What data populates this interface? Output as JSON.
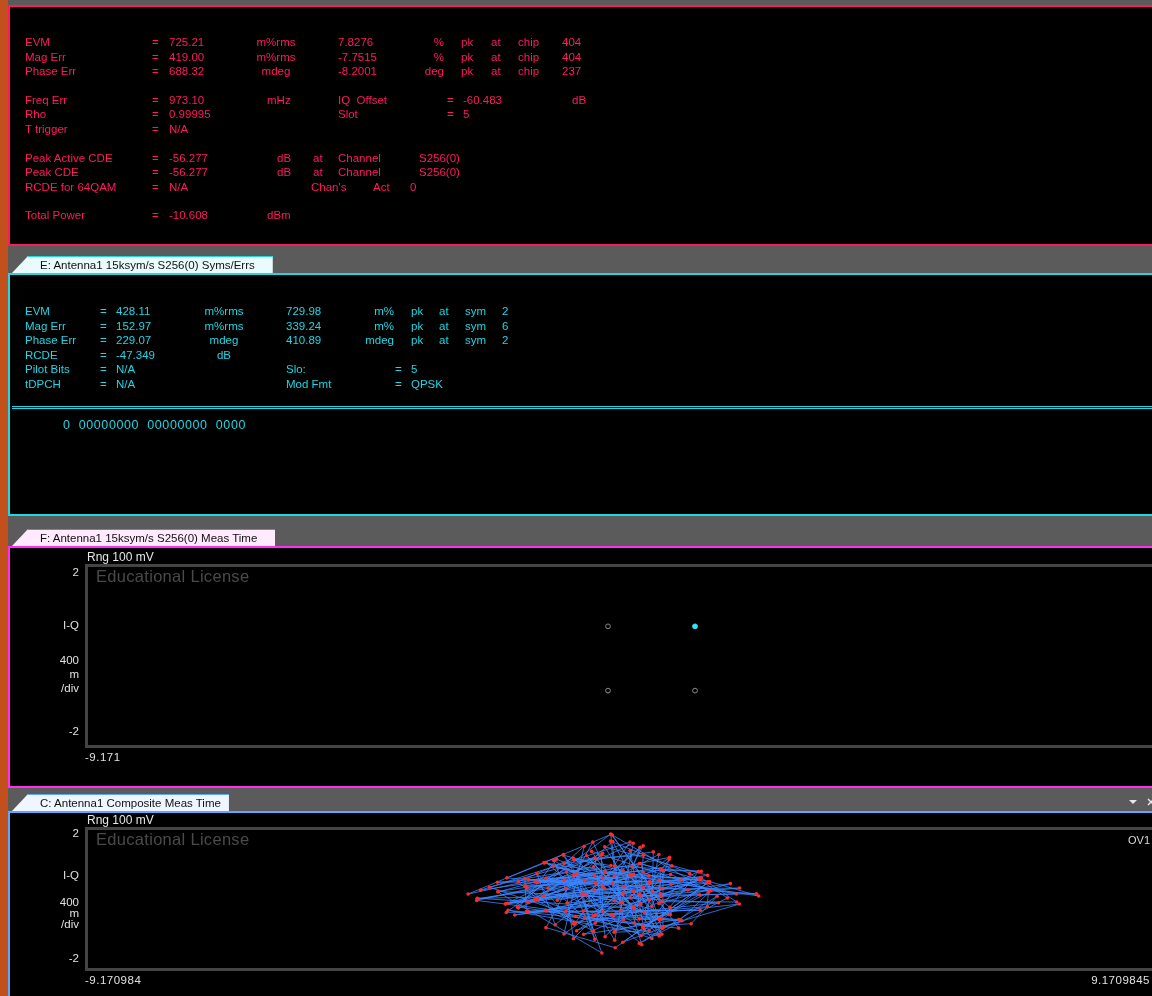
{
  "panels": [
    {
      "kind": "results",
      "color": "#ff1a5e",
      "groups": [
        [
          {
            "kind": "err",
            "cells": [
              "EVM",
              "=",
              "725.21",
              "m%rms",
              "7.8276",
              "%",
              "pk",
              "at",
              "chip",
              "404"
            ]
          },
          {
            "kind": "err",
            "cells": [
              "Mag Err",
              "=",
              "419.00",
              "m%rms",
              "-7.7515",
              "%",
              "pk",
              "at",
              "chip",
              "404"
            ]
          },
          {
            "kind": "err",
            "cells": [
              "Phase Err",
              "=",
              "688.32",
              "mdeg",
              "-8.2001",
              "deg",
              "pk",
              "at",
              "chip",
              "237"
            ]
          }
        ],
        [
          {
            "kind": "freq",
            "cells": [
              "Freq Err",
              "=",
              "973.10",
              "mHz",
              "IQ  Offset",
              "=",
              "-60.483",
              "dB"
            ]
          },
          {
            "kind": "slot",
            "cells": [
              "Rho",
              "=",
              "0.99995",
              "Slot",
              "=",
              "5"
            ]
          },
          {
            "kind": "slot",
            "cells": [
              "T trigger",
              "=",
              "N/A"
            ]
          }
        ],
        [
          {
            "kind": "cde",
            "cells": [
              "Peak Active CDE",
              "=",
              "-56.277",
              "dB",
              "at",
              "Channel",
              "S256(0)"
            ]
          },
          {
            "kind": "cde",
            "cells": [
              "Peak CDE",
              "=",
              "-56.277",
              "dB",
              "at",
              "Channel",
              "S256(0)"
            ]
          },
          {
            "kind": "act",
            "cells": [
              "RCDE for 64QAM",
              "=",
              "N/A",
              "Chan's",
              "Act",
              "0"
            ]
          }
        ],
        [
          {
            "kind": "power",
            "cells": [
              "Total Power",
              "=",
              "-10.608",
              "dBm"
            ]
          }
        ]
      ]
    },
    {
      "kind": "results",
      "tab": "E: Antenna1 15ksym/s S256(0) Syms/Errs",
      "color": "#1fd6e4",
      "groups": [
        [
          {
            "kind": "err",
            "cells": [
              "EVM",
              "=",
              "428.11",
              "m%rms",
              "729.98",
              "m%",
              "pk",
              "at",
              "sym",
              "2"
            ]
          },
          {
            "kind": "err",
            "cells": [
              "Mag Err",
              "=",
              "152.97",
              "m%rms",
              "339.24",
              "m%",
              "pk",
              "at",
              "sym",
              "6"
            ]
          },
          {
            "kind": "err",
            "cells": [
              "Phase Err",
              "=",
              "229.07",
              "mdeg",
              "410.89",
              "mdeg",
              "pk",
              "at",
              "sym",
              "2"
            ]
          },
          {
            "kind": "err",
            "cells": [
              "RCDE",
              "=",
              "-47.349",
              "dB"
            ]
          },
          {
            "kind": "slot",
            "cells": [
              "Pilot Bits",
              "=",
              "N/A",
              "Slo:",
              "=",
              "5"
            ]
          },
          {
            "kind": "slot",
            "cells": [
              "tDPCH",
              "=",
              "N/A",
              "Mod Fmt",
              "=",
              "QPSK"
            ]
          }
        ]
      ],
      "bits": "0  00000000  00000000  0000"
    },
    {
      "kind": "chart",
      "tab": "F: Antenna1 15ksym/s S256(0) Meas Time",
      "color": "#ff2ef0",
      "plot": {
        "kind": "sparse"
      },
      "range": "Rng 100 mV",
      "watermark": "Educational License",
      "y_labels": [
        [
          "2"
        ],
        [
          "I-Q"
        ],
        [
          "400",
          "m",
          "/div"
        ],
        [
          "-2"
        ]
      ],
      "x_labels": [
        "-9.171"
      ]
    },
    {
      "kind": "chart",
      "tab": "C: Antenna1 Composite Meas Time",
      "color": "#5aa8ff",
      "plot": {
        "kind": "dense"
      },
      "tab_controls": true,
      "range": "Rng 100 mV",
      "watermark": "Educational License",
      "overload": "OV1",
      "y_labels": [
        [
          "2"
        ],
        [
          "I-Q"
        ],
        [
          "400",
          "m",
          "/div"
        ],
        [
          "-2"
        ]
      ],
      "x_labels": [
        "-9.170984",
        "9.1709845"
      ]
    }
  ]
}
